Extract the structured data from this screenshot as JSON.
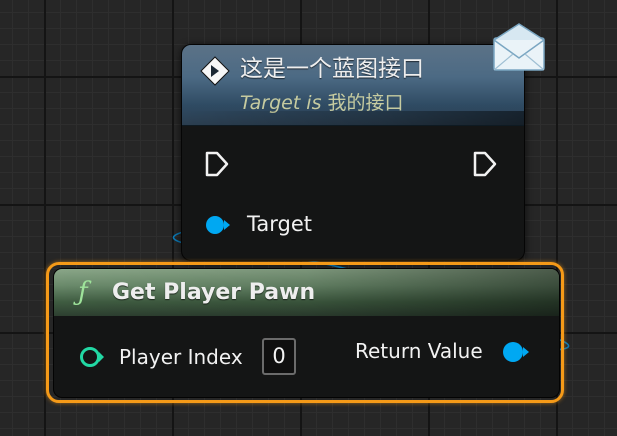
{
  "interface_node": {
    "title": "这是一个蓝图接口",
    "subtitle_prefix": "Target is",
    "subtitle_target": "我的接口",
    "pin_target_label": "Target",
    "header_icon": "message-diamond-icon",
    "badge_icon": "envelope-icon"
  },
  "function_node": {
    "icon": "ƒ",
    "title": "Get Player Pawn",
    "input_label": "Player Index",
    "input_value": "0",
    "output_label": "Return Value",
    "selected": true
  },
  "colors": {
    "object_pin": "#00a8f2",
    "int_pin": "#22d8a4",
    "selection_outline": "#f59a18",
    "exec_pin": "#ffffff"
  }
}
